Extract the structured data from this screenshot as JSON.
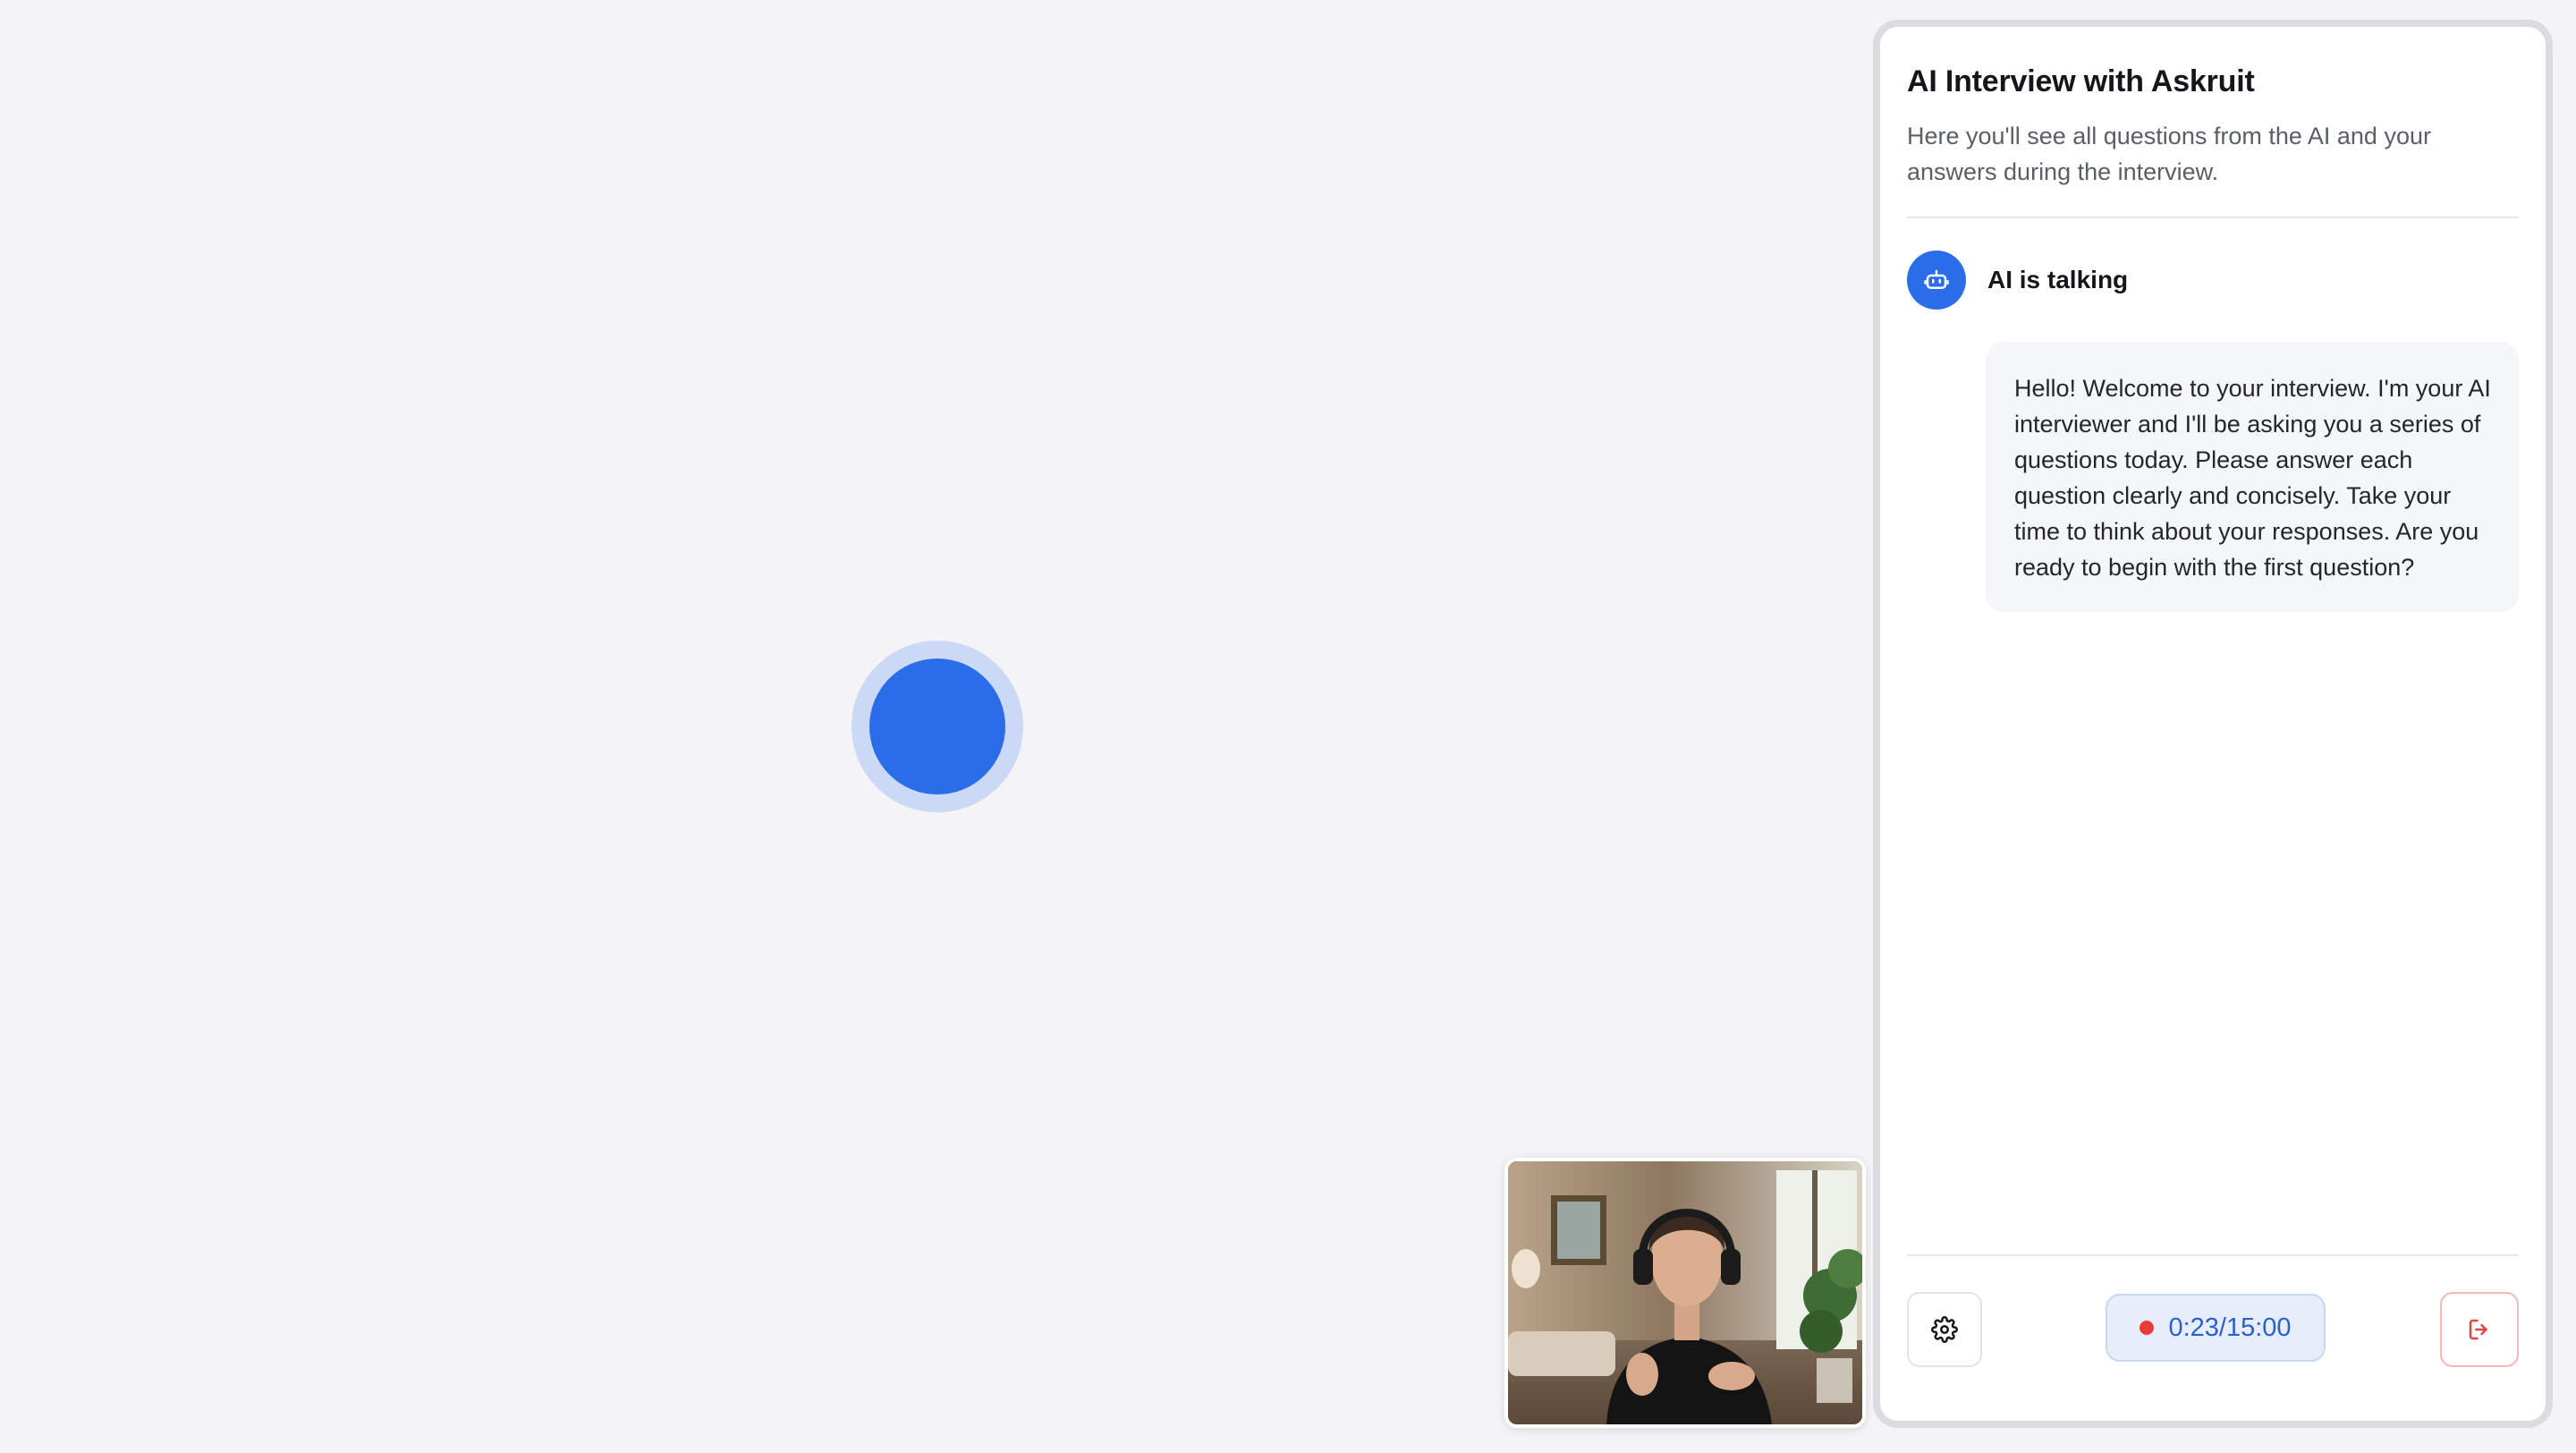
{
  "panel": {
    "title": "AI Interview with Askruit",
    "description": "Here you'll see all questions from the AI and your answers during the interview."
  },
  "conversation": {
    "speaker_label": "AI is talking",
    "speaker_icon": "robot-icon",
    "message": "Hello! Welcome to your interview. I'm your AI interviewer and I'll be asking you a series of questions today. Please answer each question clearly and concisely. Take your time to think about your responses. Are you ready to begin with the first question?"
  },
  "controls": {
    "settings_icon": "gear-icon",
    "timer": "0:23/15:00",
    "leave_icon": "exit-icon"
  },
  "colors": {
    "accent": "#2a6de8",
    "orb_halo": "#ccd9f6",
    "recording": "#ea3b3b",
    "leave": "#e04545"
  }
}
